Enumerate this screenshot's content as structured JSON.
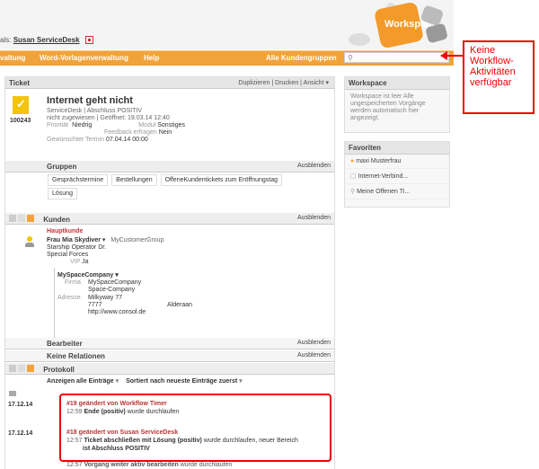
{
  "header": {
    "login_prefix": "als:",
    "login_user": "Susan ServiceDesk"
  },
  "nav": {
    "items": [
      "valtung",
      "Word-Vorlagenverwaltung",
      "Help"
    ],
    "customer_groups": "Alle Kundengruppen"
  },
  "ticket": {
    "section_title": "Ticket",
    "actions": [
      "Duplizieren",
      "Drucken",
      "Ansicht"
    ],
    "number": "100243",
    "title": "Internet geht nicht",
    "line1": "ServiceDesk | Abschluss POSITIV",
    "line2": "nicht zugewiesen | Geöffnet: 19.03.14 12:40",
    "priority_label": "Priorität",
    "priority_value": "Niedrig",
    "module_label": "Modul",
    "module_value": "Sonstiges",
    "feedback_label": "Feedback erfragen",
    "feedback_value": "Nein",
    "wish_label": "Gewünschter Termin",
    "wish_value": "07.04.14 00:00"
  },
  "groups": {
    "title": "Gruppen",
    "hide": "Ausblenden",
    "tags": [
      "Gesprächstermine",
      "Bestellungen",
      "OffeneKundentickets zum Eröffnungstag",
      "Lösung"
    ]
  },
  "customers": {
    "title": "Kunden",
    "hide": "Ausblenden",
    "main_label": "Hauptkunde",
    "name": "Frau Mia Skydiver",
    "group": "MyCustomerGroup",
    "line1": "Starship Operator Dr.",
    "line2": "Special Forces",
    "vip_label": "VIP",
    "vip_value": "Ja",
    "company": "MySpaceCompany",
    "firma_label": "Firma",
    "firma_lines": [
      "MySpaceCompany",
      "Space-Company"
    ],
    "address_label": "Adresse",
    "address_street": "Milkyway 77",
    "address_zip": "7777",
    "address_city": "Alderaan",
    "address_url": "http://www.consol.de"
  },
  "editor": {
    "title": "Bearbeiter",
    "hide": "Ausblenden"
  },
  "relations": {
    "title": "Keine Relationen",
    "hide": "Ausblenden"
  },
  "protocol": {
    "title": "Protokoll",
    "filter": "Anzeigen alle Einträge",
    "sort": "Sortiert nach neueste Einträge zuerst",
    "entries": [
      {
        "date": "17.12.14",
        "head": "#19 geändert von Workflow Timer",
        "time": "12:59",
        "bold": "Ende (positiv)",
        "text": "wurde durchlaufen",
        "extra": ""
      },
      {
        "date": "17.12.14",
        "head": "#18 geändert von Susan ServiceDesk",
        "time": "12:57",
        "bold": "Ticket abschließen mit Lösung (positiv)",
        "text": "wurde durchlaufen, neuer Bereich",
        "extra": "ist Abschluss POSITIV"
      }
    ],
    "cut_time": "12:57",
    "cut_bold": "Vorgang weiter aktiv bearbeiten",
    "cut_text": "wurde durchlaufen"
  },
  "workspace": {
    "title": "Workspace",
    "text": "Workspace ist leer Alle ungespeicherten Vorgänge werden automatisch hier angezeigt."
  },
  "favorites": {
    "title": "Favoriten",
    "items": [
      "maxi Musterfrau",
      "Internet-Verbind...",
      "Meine Offenen Ti..."
    ]
  },
  "callout": {
    "text": "Keine Workflow-Aktivitäten verfügbar"
  }
}
